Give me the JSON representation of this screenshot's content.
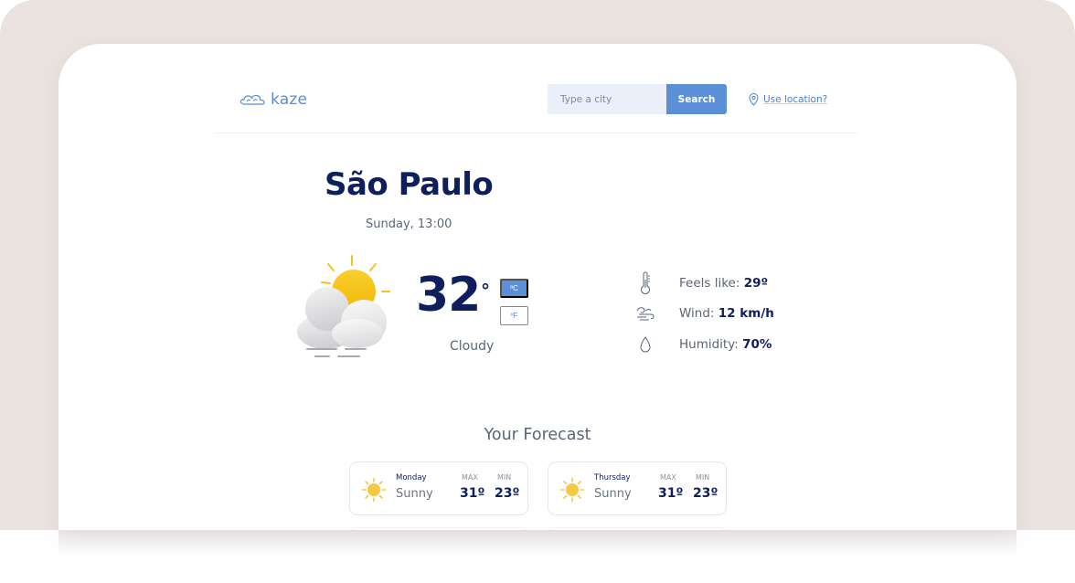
{
  "brand": {
    "name": "kaze",
    "logo_icon": "cloud-logo-icon"
  },
  "search": {
    "placeholder": "Type a city",
    "button_label": "Search"
  },
  "location": {
    "label": "Use location?",
    "icon": "map-pin-icon"
  },
  "current": {
    "city": "São Paulo",
    "datetime": "Sunday, 13:00",
    "temperature": "32",
    "degree_symbol": "°",
    "unit_celsius": "ºC",
    "unit_fahrenheit": "ºF",
    "active_unit": "celsius",
    "condition": "Cloudy",
    "condition_icon": "partly-cloudy-windy-icon"
  },
  "details": [
    {
      "icon": "thermometer-icon",
      "label": "Feels like: ",
      "value": "29º"
    },
    {
      "icon": "wind-icon",
      "label": "Wind: ",
      "value": "12 km/h"
    },
    {
      "icon": "droplet-icon",
      "label": "Humidity: ",
      "value": "70%"
    }
  ],
  "forecast": {
    "title": "Your Forecast",
    "max_label": "MAX",
    "min_label": "MIN",
    "days": [
      {
        "day": "Monday",
        "condition": "Sunny",
        "max": "31º",
        "min": "23º",
        "icon": "sun-icon"
      },
      {
        "day": "Thursday",
        "condition": "Sunny",
        "max": "31º",
        "min": "23º",
        "icon": "sun-icon"
      }
    ]
  },
  "colors": {
    "accent": "#5b8fd8",
    "heading": "#0f1f5c",
    "muted_text": "#5b6476",
    "sun": "#f7c843",
    "backdrop": "#ebe3e0"
  }
}
